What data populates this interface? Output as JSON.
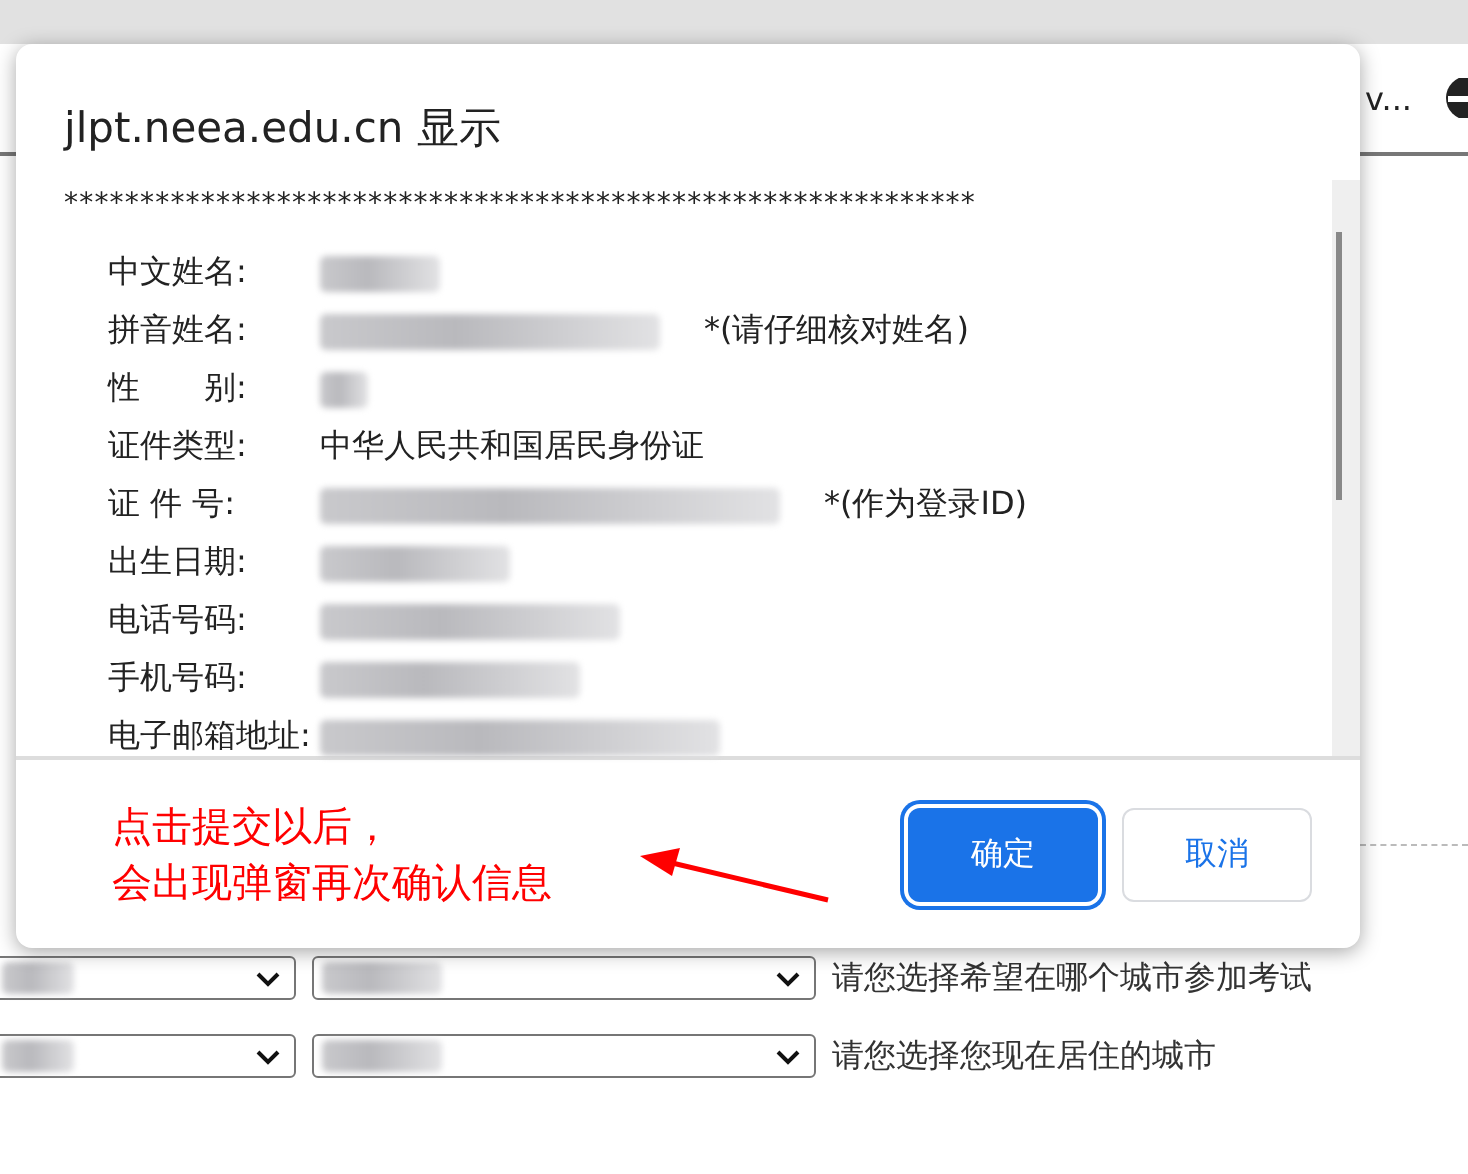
{
  "browser_bar": {
    "tab_text": "v..."
  },
  "dialog": {
    "title": "jlpt.neea.edu.cn 显示",
    "separator": "************************************************************",
    "rows": [
      {
        "label": "中文姓名:",
        "hidden_value": true
      },
      {
        "label": "拼音姓名:",
        "hidden_value": true,
        "note": "*(请仔细核对姓名)"
      },
      {
        "label": "性　　别:",
        "hidden_value": true
      },
      {
        "label": "证件类型:",
        "value": "中华人民共和国居民身份证",
        "hidden_value": false
      },
      {
        "label": "证 件 号:",
        "hidden_value": true,
        "note": "*(作为登录ID)"
      },
      {
        "label": "出生日期:",
        "hidden_value": true
      },
      {
        "label": "电话号码:",
        "hidden_value": true
      },
      {
        "label": "手机号码:",
        "hidden_value": true
      },
      {
        "label": "电子邮箱地址:",
        "hidden_value": true
      }
    ],
    "buttons": [
      {
        "label": "确定",
        "kind": "primary"
      },
      {
        "label": "取消",
        "kind": "secondary"
      }
    ]
  },
  "annotation": {
    "lines": [
      "点击提交以后，",
      "会出现弹窗再次确认信息"
    ]
  },
  "form_rows": [
    {
      "hint": "请您选择希望在哪个城市参加考试"
    },
    {
      "hint": "请您选择您现在居住的城市"
    }
  ]
}
